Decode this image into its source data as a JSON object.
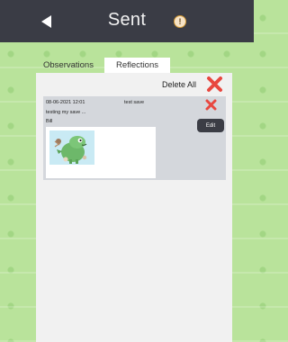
{
  "header": {
    "title": "Sent",
    "back_icon": "back-arrow-icon",
    "info_icon": "info-icon",
    "info_symbol": "!"
  },
  "tabs": [
    {
      "label": "Observations",
      "active": true
    },
    {
      "label": "Reflections",
      "active": false
    }
  ],
  "toolbar": {
    "delete_all_label": "Delete All"
  },
  "entries": [
    {
      "date": "08-06-2021 12:01",
      "title": "test save",
      "text": "testing my save ...",
      "author": "Bill",
      "edit_label": "Edit",
      "image_icon": "dinosaur-drawing"
    }
  ],
  "colors": {
    "header_bg": "#3a3c45",
    "background_grass": "#b9e39b",
    "delete_red": "#e8473f",
    "card_bg": "#d4d7dc"
  }
}
